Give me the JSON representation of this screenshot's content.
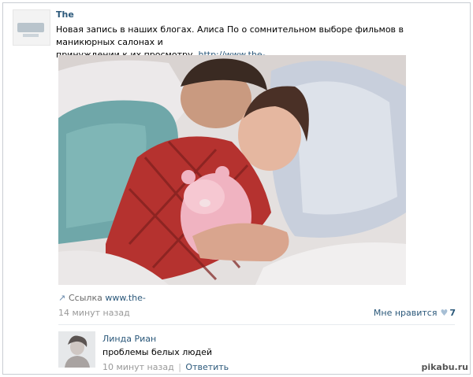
{
  "post": {
    "author": "The",
    "text_line1": "Новая запись в наших блогах. Алиса По о сомнительном выборе фильмов в маникюрных салонах и",
    "text_line2_prefix": "принуждении к их просмотру. ",
    "text_link": "http://www.the-",
    "share_label": "Ссылка",
    "share_link": "www.the-",
    "time": "14 минут назад",
    "likes_label": "Мне нравится",
    "likes_count": "7",
    "colors": {
      "link": "#2b587a",
      "meta": "#999999"
    }
  },
  "comment": {
    "author": "Линда Риан",
    "text": "проблемы белых людей",
    "time": "10 минут назад",
    "separator": "|",
    "reply_label": "Ответить"
  },
  "watermark": {
    "text": "pikabu.ru"
  }
}
